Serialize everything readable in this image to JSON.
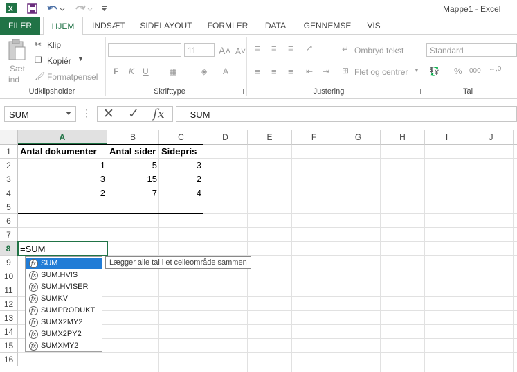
{
  "window": {
    "title": "Mappe1 - Excel"
  },
  "tabs": [
    "FILER",
    "HJEM",
    "INDSÆT",
    "SIDELAYOUT",
    "FORMLER",
    "DATA",
    "GENNEMSE",
    "VIS"
  ],
  "ribbon": {
    "clipboard": {
      "paste": "Sæt",
      "paste2": "ind",
      "cut": "Klip",
      "copy": "Kopiér",
      "format_painter": "Formatpensel",
      "label": "Udklipsholder"
    },
    "font": {
      "size": "11",
      "bold": "F",
      "italic": "K",
      "underline": "U",
      "label": "Skrifttype"
    },
    "alignment": {
      "wrap": "Ombryd tekst",
      "merge": "Flet og centrer",
      "label": "Justering"
    },
    "number": {
      "format": "Standard",
      "percent": "%",
      "thousands": "000",
      "label": "Tal"
    }
  },
  "formula_bar": {
    "name_box": "SUM",
    "formula": "=SUM"
  },
  "columns": [
    "A",
    "B",
    "C",
    "D",
    "E",
    "F",
    "G",
    "H",
    "I",
    "J"
  ],
  "rows": [
    "1",
    "2",
    "3",
    "4",
    "5",
    "6",
    "7",
    "8",
    "9",
    "10",
    "11",
    "12",
    "13",
    "14",
    "15",
    "16"
  ],
  "cells": {
    "A1": "Antal dokumenter",
    "B1": "Antal sider",
    "C1": "Sidepris",
    "A2": "1",
    "B2": "5",
    "C2": "3",
    "A3": "3",
    "B3": "15",
    "C3": "2",
    "A4": "2",
    "B4": "7",
    "C4": "4",
    "A8": "=SUM"
  },
  "autocomplete": {
    "items": [
      "SUM",
      "SUM.HVIS",
      "SUM.HVISER",
      "SUMKV",
      "SUMPRODUKT",
      "SUMX2MY2",
      "SUMX2PY2",
      "SUMXMY2"
    ],
    "selected_index": 0,
    "tooltip": "Lægger alle tal i et celleområde sammen"
  },
  "colors": {
    "accent": "#217346",
    "selection": "#217cd6"
  }
}
